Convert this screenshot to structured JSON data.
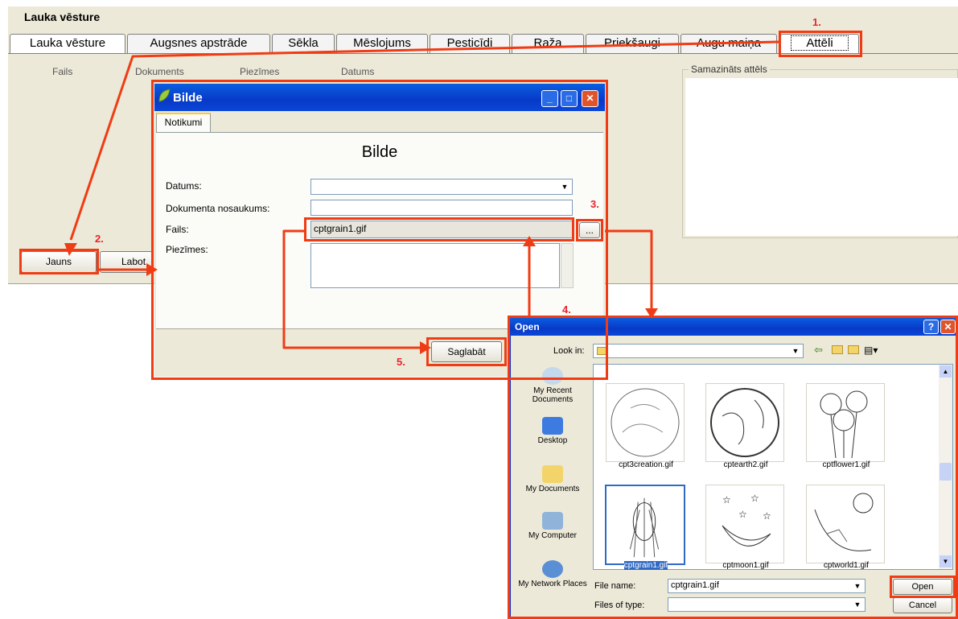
{
  "app": {
    "title": "Lauka vēsture",
    "tabs": [
      "Lauka vēsture",
      "Augsnes apstrāde",
      "Sēkla",
      "Mēslojums",
      "Pesticīdi",
      "Raža",
      "Priekšaugi",
      "Augu maiņa",
      "Attēli"
    ],
    "columns": [
      "Fails",
      "Dokuments",
      "Piezīmes",
      "Datums"
    ],
    "thumbnail_legend": "Samazināts attēls",
    "new_button": "Jauns",
    "edit_button_partial": "Labot"
  },
  "bilde": {
    "title": "Bilde",
    "tab": "Notikumi",
    "heading": "Bilde",
    "labels": {
      "date": "Datums:",
      "doc_name": "Dokumenta nosaukums:",
      "file": "Fails:",
      "notes": "Piezīmes:"
    },
    "values": {
      "date": "",
      "doc_name": "",
      "file": "cptgrain1.gif",
      "notes": ""
    },
    "browse_button": "...",
    "save_button": "Saglabāt"
  },
  "open_dialog": {
    "title": "Open",
    "look_in_label": "Look in:",
    "places": [
      "My Recent Documents",
      "Desktop",
      "My Documents",
      "My Computer",
      "My Network Places"
    ],
    "files": [
      {
        "name": "cpt3creation.gif",
        "selected": false
      },
      {
        "name": "cptearth2.gif",
        "selected": false
      },
      {
        "name": "cptflower1.gif",
        "selected": false
      },
      {
        "name": "cptgrain1.gif",
        "selected": true
      },
      {
        "name": "cptmoon1.gif",
        "selected": false
      },
      {
        "name": "cptworld1.gif",
        "selected": false
      }
    ],
    "file_name_label": "File name:",
    "file_name_value": "cptgrain1.gif",
    "file_type_label": "Files of type:",
    "file_type_value": "",
    "open_button": "Open",
    "cancel_button": "Cancel"
  },
  "annotations": [
    "1.",
    "2.",
    "3.",
    "4.",
    "5."
  ],
  "colors": {
    "highlight": "#f03c14",
    "number": "#e8242c",
    "titlebar": "#0a46d6",
    "selection": "#316ac5"
  }
}
